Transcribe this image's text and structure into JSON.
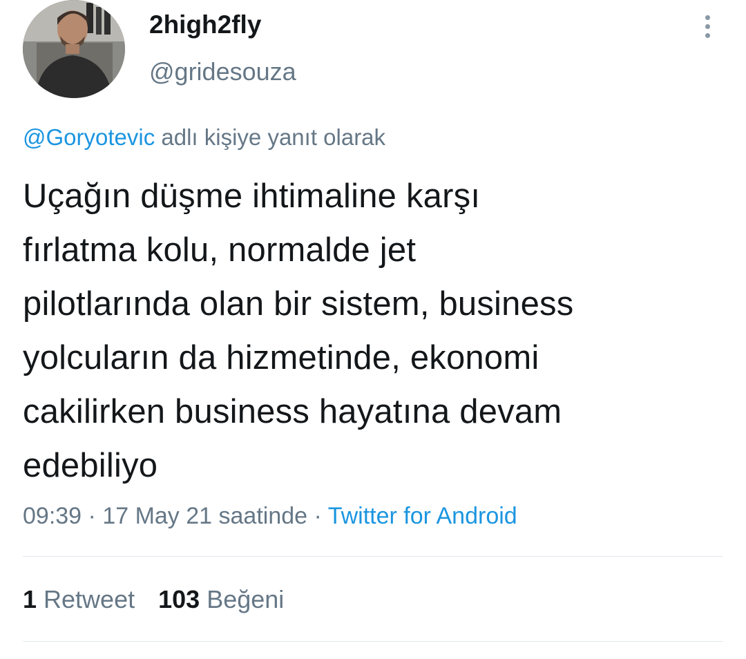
{
  "author": {
    "display_name": "2high2fly",
    "handle": "@gridesouza"
  },
  "reply": {
    "mention": "@Goryotevic",
    "suffix": " adlı kişiye yanıt olarak"
  },
  "tweet": {
    "lines": [
      "Uçağın düşme ihtimaline karşı",
      "fırlatma kolu, normalde jet",
      "pilotlarında olan bir sistem, business",
      "yolcuların da hizmetinde, ekonomi",
      "cakilirken business hayatına devam",
      "edebiliyo"
    ],
    "time": "09:39",
    "separator": " · ",
    "date_text": "17 May 21 saatinde",
    "source": "Twitter for Android"
  },
  "stats": {
    "retweets_count": "1",
    "retweets_label": " Retweet",
    "likes_count": "103",
    "likes_label": " Beğeni"
  },
  "icons": {
    "avatar": "profile-photo",
    "more": "more-vertical-icon"
  },
  "colors": {
    "link": "#1b95e0",
    "secondary_text": "#657786",
    "primary_text": "#14171a",
    "divider": "#e1e8ed"
  }
}
